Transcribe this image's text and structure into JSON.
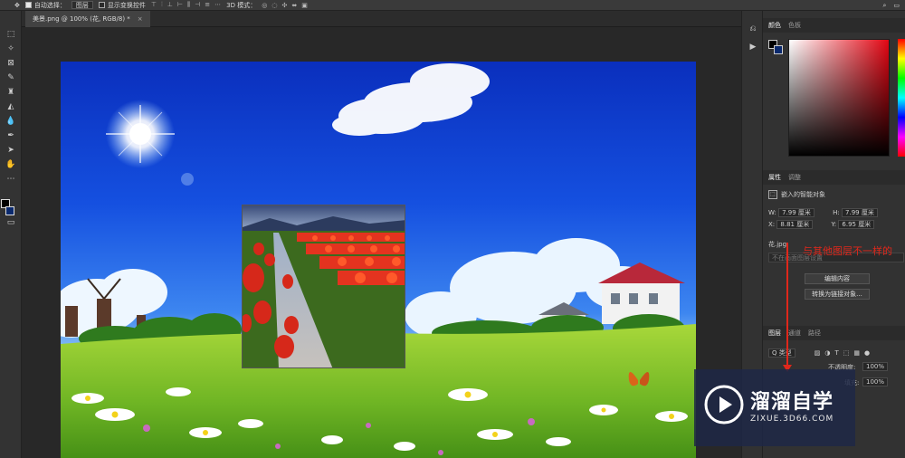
{
  "options_bar": {
    "auto_select_label": "自动选择：",
    "target_value": "图层",
    "transform_controls_label": "显示变换控件",
    "mode_label": "3D 模式："
  },
  "document": {
    "tab_title": "美景.png @ 100% (花, RGB/8) *",
    "close_glyph": "×"
  },
  "panels": {
    "color_tabs": [
      "颜色",
      "色板"
    ],
    "props_tabs": [
      "属性",
      "调整"
    ],
    "smart_object_label": "嵌入的智能对象",
    "w_label": "W:",
    "w_value": "7.99 厘米",
    "h_label": "H:",
    "h_value": "7.99 厘米",
    "x_label": "X:",
    "x_value": "8.81 厘米",
    "y_label": "Y:",
    "y_value": "6.95 厘米",
    "file_name": "花.jpg",
    "comp_placeholder": "不在画面图层设置",
    "edit_contents_button": "编辑内容",
    "convert_button": "转换为链接对象...",
    "layers_tabs": [
      "图层",
      "通道",
      "路径"
    ],
    "kind_filter": "Q 类型",
    "opacity_label": "不透明度:",
    "opacity_value": "100%",
    "fill_label": "填充:",
    "fill_value": "100%"
  },
  "annotation": {
    "text": "与其他图层不一样的",
    "color": "#e0271b"
  },
  "watermark": {
    "title": "溜溜自学",
    "subtitle": "ZIXUE.3D66.COM"
  },
  "colors": {
    "foreground": "#000000",
    "background": "#0b2a6e",
    "annotation": "#e0271b"
  },
  "icons": {
    "move_tool": "move-icon",
    "search": "search-icon",
    "play": "play-icon"
  }
}
